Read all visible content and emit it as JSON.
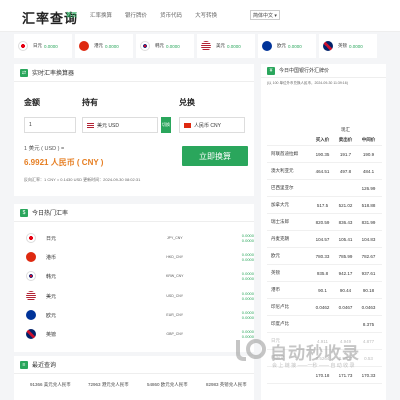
{
  "header": {
    "logo": "汇率查询",
    "nav": [
      "首页",
      "汇率换算",
      "银行牌价",
      "货币代码",
      "大写转换"
    ],
    "lang": "简体中文 ▾"
  },
  "rates_bar": [
    {
      "name": "日元",
      "value": "0.0000",
      "color": "#e60012"
    },
    {
      "name": "港元",
      "value": "0.0000",
      "color": "#de2910"
    },
    {
      "name": "韩元",
      "value": "0.0000",
      "color": "#0047a0"
    },
    {
      "name": "美元",
      "value": "0.0000",
      "color": "#3c3b6e"
    },
    {
      "name": "欧元",
      "value": "0.0000",
      "color": "#003399"
    },
    {
      "name": "英镑",
      "value": "0.0000",
      "color": "#012169"
    }
  ],
  "converter": {
    "title": "实时汇率换算器",
    "amount_label": "金额",
    "amount_value": "1",
    "from_label": "持有",
    "from_value": "美元 USD",
    "swap_label": "切换",
    "to_label": "兑换",
    "to_value": "人民币 CNY",
    "result_line1": "1 美元 ( USD ) =",
    "result_line2": "6.9921 人民币 ( CNY )",
    "reverse": "反向汇率：1 CNY = 0.1430 USD   更新时间：2024-09-30 08:02:31",
    "button": "立即换算"
  },
  "hot": {
    "title": "今日热门汇率",
    "rows": [
      {
        "name": "日元",
        "code": "JPY_CNY",
        "a": "0.0000",
        "b": "0.0000",
        "color": "#e60012"
      },
      {
        "name": "港币",
        "code": "HKD_CNY",
        "a": "0.0000",
        "b": "0.0000",
        "color": "#de2910"
      },
      {
        "name": "韩元",
        "code": "KRW_CNY",
        "a": "0.0000",
        "b": "0.0000",
        "color": "#0047a0"
      },
      {
        "name": "美元",
        "code": "USD_CNY",
        "a": "0.0000",
        "b": "0.0000",
        "color": "#3c3b6e"
      },
      {
        "name": "欧元",
        "code": "EUR_CNY",
        "a": "0.0000",
        "b": "0.0000",
        "color": "#003399"
      },
      {
        "name": "英镑",
        "code": "GBP_CNY",
        "a": "0.0000",
        "b": "0.0000",
        "color": "#012169"
      }
    ]
  },
  "recent": {
    "title": "最近查询",
    "items": [
      "91366 美元兑人民币",
      "72963 港元兑人民币",
      "54860 欧元兑人民币",
      "82983 英镑兑人民币"
    ]
  },
  "bank": {
    "title": "今日中国银行外汇牌价",
    "subtitle": "(以 100 单位外币兑换人民币，2024-09-30 11:39:16)",
    "head_group": "现汇",
    "head": [
      "",
      "买入价",
      "卖出价",
      "中间价"
    ],
    "rows": [
      [
        "阿联酋迪拉姆",
        "190.35",
        "191.7",
        "190.9"
      ],
      [
        "澳大利亚元",
        "464.51",
        "497.8",
        "484.1"
      ],
      [
        "巴西里亚尔",
        "",
        "",
        "126.99"
      ],
      [
        "加拿大元",
        "517.5",
        "521.02",
        "518.88"
      ],
      [
        "瑞士法郎",
        "820.59",
        "836.43",
        "831.99"
      ],
      [
        "丹麦克朗",
        "104.57",
        "105.41",
        "104.83"
      ],
      [
        "欧元",
        "780.33",
        "785.99",
        "782.67"
      ],
      [
        "英镑",
        "935.8",
        "942.17",
        "937.61"
      ],
      [
        "港币",
        "90.1",
        "90.44",
        "90.18"
      ],
      [
        "印尼卢比",
        "0.0462",
        "0.0467",
        "0.0463"
      ],
      [
        "印度卢比",
        "",
        "",
        "8.375"
      ],
      [
        "日元",
        "4.911",
        "4.949",
        "4.877"
      ],
      [
        "韩国元",
        "0.5264",
        "0.5307",
        "0.53"
      ],
      [
        "",
        "170.18",
        "171.73",
        "170.33"
      ]
    ]
  },
  "watermark": {
    "text": "自动秒收录",
    "sub": "会 上 链 接 ——一秒 —— 自 动 收 录"
  }
}
